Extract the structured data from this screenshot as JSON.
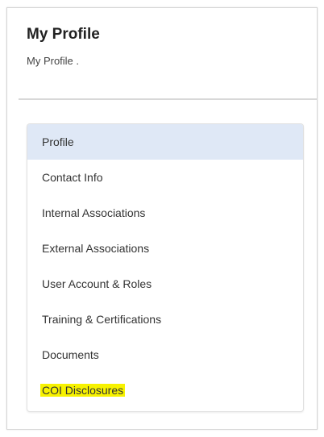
{
  "header": {
    "title": "My Profile",
    "breadcrumb": "My Profile ."
  },
  "sidebar": {
    "items": [
      {
        "label": "Profile",
        "active": true
      },
      {
        "label": "Contact Info"
      },
      {
        "label": "Internal Associations"
      },
      {
        "label": "External Associations"
      },
      {
        "label": "User Account & Roles"
      },
      {
        "label": "Training & Certifications"
      },
      {
        "label": "Documents"
      },
      {
        "label": "COI Disclosures",
        "highlighted": true
      }
    ]
  },
  "colors": {
    "active_bg": "#dfe8f6",
    "highlight": "#f7f200"
  }
}
